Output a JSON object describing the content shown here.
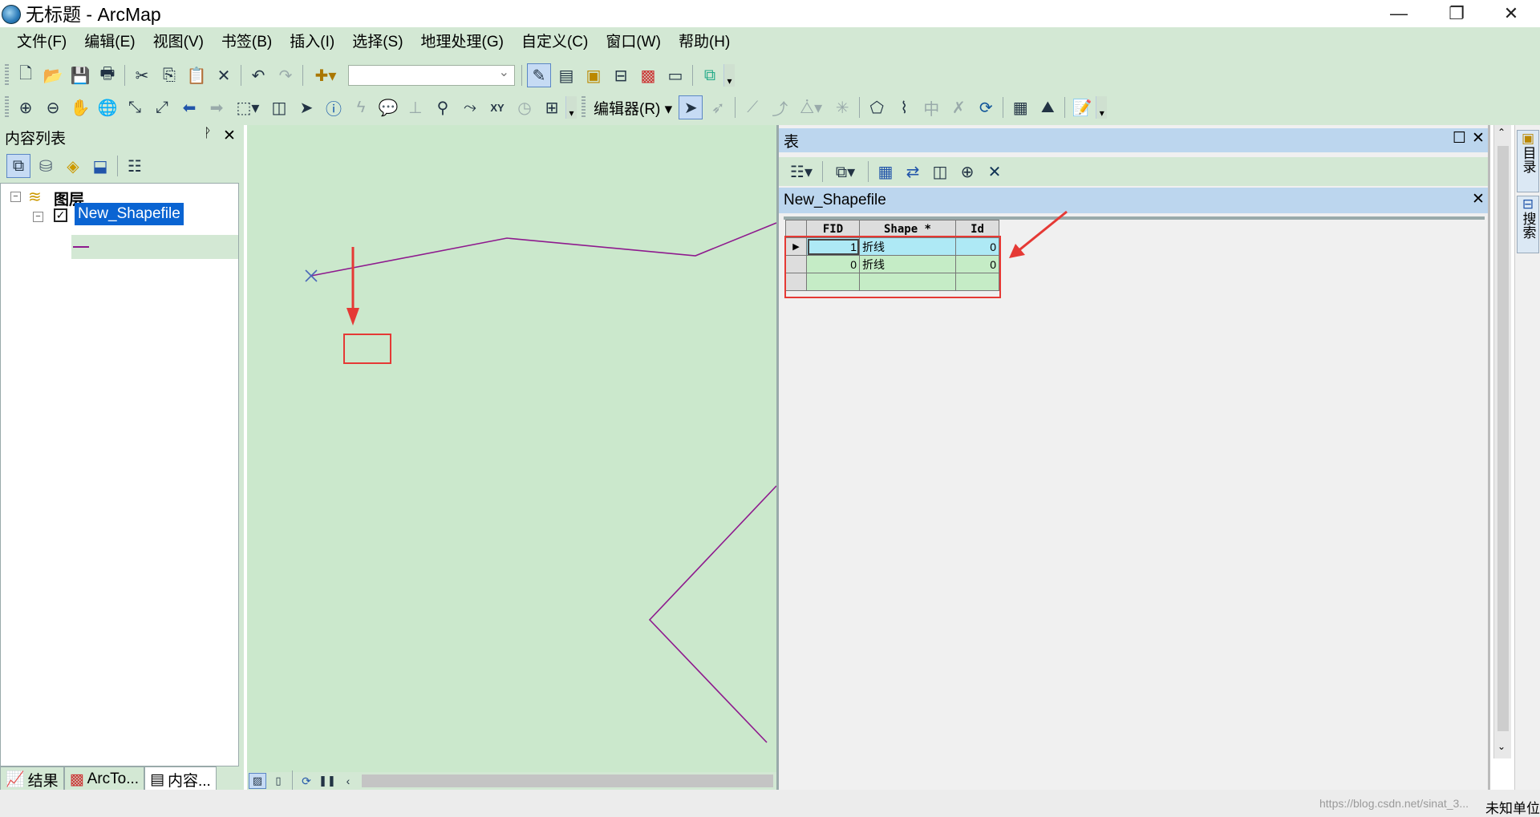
{
  "window": {
    "title": "无标题 - ArcMap",
    "minimize": "—",
    "restore": "❐",
    "close": "✕"
  },
  "menu": [
    "文件(F)",
    "编辑(E)",
    "视图(V)",
    "书签(B)",
    "插入(I)",
    "选择(S)",
    "地理处理(G)",
    "自定义(C)",
    "窗口(W)",
    "帮助(H)"
  ],
  "toolbar": {
    "editor_label": "编辑器(R)",
    "scale_value": ""
  },
  "toc": {
    "title": "内容列表",
    "pin": "ᚹ",
    "close": "✕",
    "root_label": "图层",
    "layer_name": "New_Shapefile",
    "layer_checked": true,
    "tabs": [
      "结果",
      "ArcTo...",
      "内容..."
    ],
    "active_tab": 2
  },
  "table": {
    "window_title": "表",
    "maximize": "☐",
    "close": "✕",
    "tab_name": "New_Shapefile",
    "columns": [
      "FID",
      "Shape *",
      "Id"
    ],
    "rows": [
      {
        "FID": "1",
        "Shape": "折线",
        "Id": "0",
        "current": true
      },
      {
        "FID": "0",
        "Shape": "折线",
        "Id": "0",
        "current": false
      }
    ]
  },
  "dock": {
    "catalog": "目录",
    "search": "搜索"
  },
  "status": {
    "watermark": "https://blog.csdn.net/sinat_3...",
    "corner": "未知单位"
  },
  "colors": {
    "map_bg": "#cbe8cc",
    "line": "#8e1a8e",
    "annotation": "#e53935",
    "selection": "#0a64d2"
  }
}
